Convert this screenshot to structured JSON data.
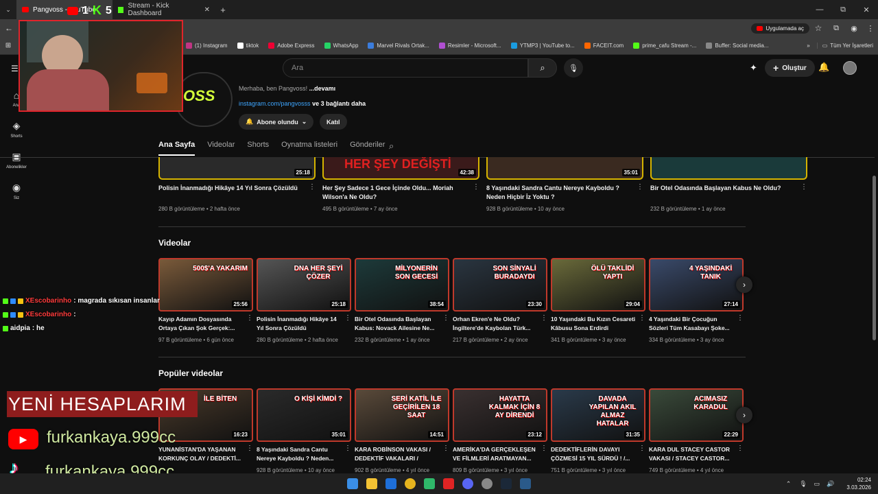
{
  "browser": {
    "tabs": [
      {
        "label": "Pangvoss - YouTube",
        "active": true
      },
      {
        "label": "Stream - Kick Dashboard",
        "active": false
      }
    ],
    "new_tab": "+",
    "window": [
      "—",
      "⧉",
      "✕"
    ],
    "open_in_app": "Uygulamada aç",
    "bookmarks": [
      {
        "label": "(1) Instagram",
        "color": "#c13584"
      },
      {
        "label": "tiktok",
        "color": "#fff"
      },
      {
        "label": "Adobe Express",
        "color": "#e03"
      },
      {
        "label": "WhatsApp",
        "color": "#25d366"
      },
      {
        "label": "Marvel Rivals Ortak...",
        "color": "#3b7ddd"
      },
      {
        "label": "Resimler - Microsoft...",
        "color": "#b04fd1"
      },
      {
        "label": "YTMP3 | YouTube to...",
        "color": "#1a9ce0"
      },
      {
        "label": "FACEIT.com",
        "color": "#f60"
      },
      {
        "label": "prime_cafu Stream -...",
        "color": "#53fc18"
      },
      {
        "label": "Buffer: Social media...",
        "color": "#888"
      }
    ],
    "all_bookmarks": "Tüm Yer İşaretleri"
  },
  "youtube": {
    "search_placeholder": "Ara",
    "create_label": "Oluştur",
    "sidebar": [
      {
        "label": "Ana",
        "icon": "home-icon"
      },
      {
        "label": "Shorts",
        "icon": "shorts-icon"
      },
      {
        "label": "Abonelikler",
        "icon": "subscriptions-icon"
      },
      {
        "label": "Siz",
        "icon": "profile-icon"
      }
    ],
    "channel": {
      "description": "Merhaba, ben Pangvoss!",
      "more": "...devamı",
      "link": "instagram.com/pangvosss",
      "links_more": "ve 3 bağlantı daha",
      "subscribed": "Abone olundu",
      "join": "Katıl",
      "avatar_text": "OSS"
    },
    "tabs": [
      "Ana Sayfa",
      "Videolar",
      "Shorts",
      "Oynatma listeleri",
      "Gönderiler"
    ],
    "top_row": [
      {
        "title": "Polisin İnanmadığı Hikâye 14 Yıl Sonra Çözüldü",
        "meta": "280 B görüntüleme • 2 hafta önce",
        "duration": "25:18",
        "overlay": ""
      },
      {
        "title": "Her Şey Sadece 1 Gece İçinde Oldu... Moriah Wilson'a Ne Oldu?",
        "meta": "495 B görüntüleme • 7 ay önce",
        "duration": "42:38",
        "overlay": "HER ŞEY DEĞİŞTİ"
      },
      {
        "title": "8 Yaşındaki Sandra Cantu Nereye Kayboldu ? Neden Hiçbir İz Yoktu ?",
        "meta": "928 B görüntüleme • 10 ay önce",
        "duration": "35:01",
        "overlay": ""
      },
      {
        "title": "Bir Otel Odasında Başlayan Kabus Ne Oldu?",
        "meta": "232 B görüntüleme • 1 ay önce",
        "duration": "",
        "overlay": ""
      }
    ],
    "videos_title": "Videolar",
    "videos": [
      {
        "title": "Kayıp Adamın Dosyasında Ortaya Çıkan Şok Gerçek:...",
        "meta": "97 B görüntüleme • 6 gün önce",
        "duration": "25:56",
        "overlay": "500$'A YAKARIM",
        "bg": "#7a5a3a"
      },
      {
        "title": "Polisin İnanmadığı Hikâye 14 Yıl Sonra Çözüldü",
        "meta": "280 B görüntüleme • 2 hafta önce",
        "duration": "25:18",
        "overlay": "DNA HER ŞEYİ ÇÖZER",
        "bg": "#555"
      },
      {
        "title": "Bir Otel Odasında Başlayan Kabus: Novack Ailesine Ne...",
        "meta": "232 B görüntüleme • 1 ay önce",
        "duration": "38:54",
        "overlay": "MİLYONERİN SON GECESİ",
        "bg": "#1d3a3a"
      },
      {
        "title": "Orhan Ekren'e Ne Oldu? İngiltere'de Kaybolan Türk...",
        "meta": "217 B görüntüleme • 2 ay önce",
        "duration": "23:30",
        "overlay": "SON SİNYALİ BURADAYDI",
        "bg": "#2a3540"
      },
      {
        "title": "10 Yaşındaki Bu Kızın Cesareti Kâbusu Sona Erdirdi",
        "meta": "341 B görüntüleme • 3 ay önce",
        "duration": "29:04",
        "overlay": "ÖLÜ TAKLİDİ YAPTI",
        "bg": "#6a6a3a"
      },
      {
        "title": "4 Yaşındaki Bir Çocuğun Sözleri Tüm Kasabayı Şoke...",
        "meta": "334 B görüntüleme • 3 ay önce",
        "duration": "27:14",
        "overlay": "4 YAŞINDAKİ TANIK",
        "bg": "#3a4a6a"
      }
    ],
    "popular_title": "Popüler videolar",
    "popular": [
      {
        "title": "YUNANİSTAN'DA YAŞANAN KORKUNÇ OLAY / DEDEKTİ...",
        "meta": "",
        "duration": "16:23",
        "overlay": "İLE BİTEN",
        "bg": "#4a3a2a"
      },
      {
        "title": "8 Yaşındaki Sandra Cantu Nereye Kayboldu ? Neden...",
        "meta": "928 B görüntüleme • 10 ay önce",
        "duration": "35:01",
        "overlay": "O KİŞİ KİMDİ ?",
        "bg": "#2a2a2a"
      },
      {
        "title": "KARA ROBİNSON VAKASI / DEDEKTİF VAKALARI /",
        "meta": "902 B görüntüleme • 4 yıl önce",
        "duration": "14:51",
        "overlay": "SERİ KATİL İLE GEÇİRİLEN 18 SAAT",
        "bg": "#5a4a3a"
      },
      {
        "title": "AMERİKA'DA GERÇEKLEŞEN VE FİLMLERİ ARATMAYAN...",
        "meta": "809 B görüntüleme • 3 yıl önce",
        "duration": "23:12",
        "overlay": "HAYATTA KALMAK İÇİN 8 AY DİRENDİ",
        "bg": "#3a3030"
      },
      {
        "title": "DEDEKTİFLERİN DAVAYI ÇÖZMESİ 15 YIL SÜRDÜ ! /...",
        "meta": "751 B görüntüleme • 3 yıl önce",
        "duration": "31:35",
        "overlay": "DAVADA YAPILAN AKIL ALMAZ HATALAR",
        "bg": "#2a3a4a"
      },
      {
        "title": "KARA DUL STACEY CASTOR VAKASI / STACEY CASTOR...",
        "meta": "749 B görüntüleme • 4 yıl önce",
        "duration": "22:29",
        "overlay": "ACIMASIZ KARADUL",
        "bg": "#3a4a3a"
      }
    ]
  },
  "overlay": {
    "chat": [
      {
        "user": "XEscobarinho",
        "msg": ": magrada sıkısan insanlar",
        "color": "#ff3b3b"
      },
      {
        "user": "XEscobarinho",
        "msg": ":",
        "color": "#ff3b3b"
      },
      {
        "user": "aidpia",
        "msg": ": he",
        "color": "#fff"
      }
    ],
    "banner": "YENİ HESAPLARIM",
    "handle_yt": "furkankaya.999cc",
    "handle_tt": "furkankaya.999cc",
    "kick_counts": [
      "1",
      "5"
    ]
  },
  "taskbar": {
    "time": "02:24",
    "date": "3.03.2026"
  }
}
